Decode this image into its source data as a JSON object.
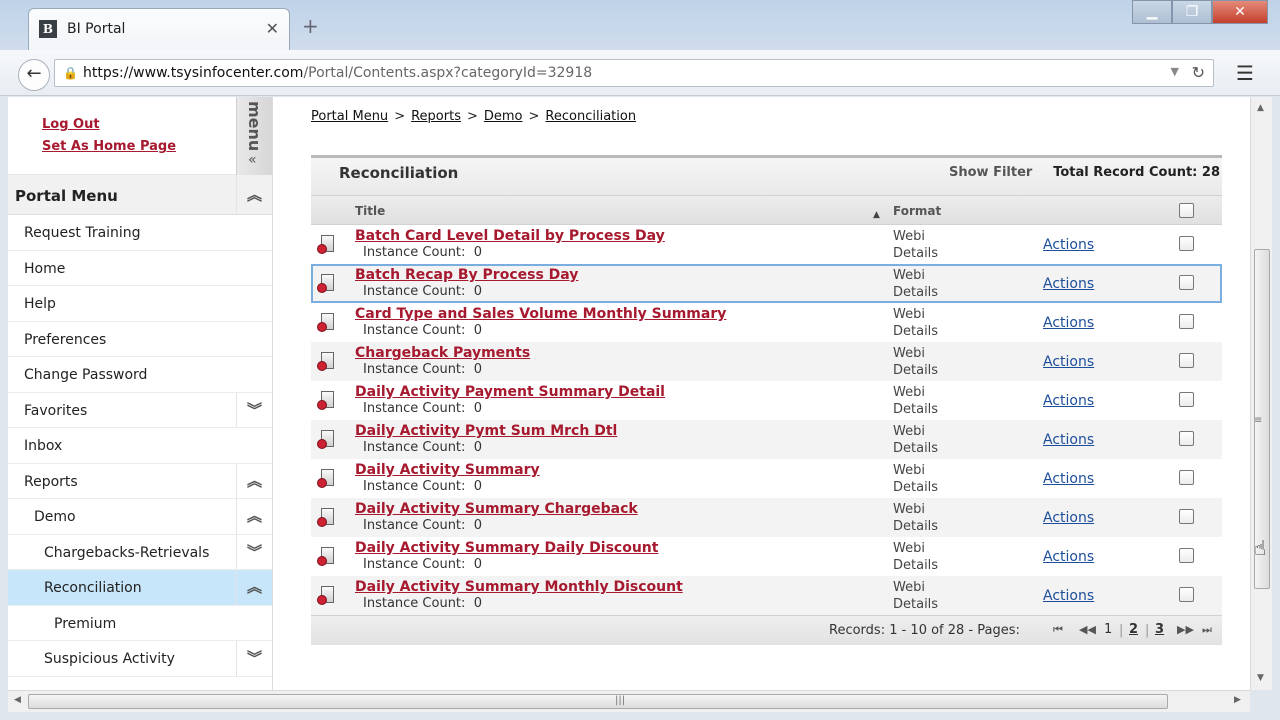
{
  "browser": {
    "tab_title": "BI Portal",
    "tab_favicon": "B",
    "new_tab": "+",
    "url_host": "https://www.tsysinfocenter.com",
    "url_path": "/Portal/Contents.aspx?categoryId=32918",
    "icons": [
      "back-arrow-icon",
      "lock-icon",
      "reload-icon",
      "hamburger-menu-icon",
      "minimize-icon",
      "maximize-icon",
      "close-icon"
    ]
  },
  "sidebar": {
    "logout": "Log Out",
    "set_home": "Set As Home Page",
    "menu_handle": "menu",
    "portal_menu": "Portal Menu",
    "items": [
      {
        "label": "Request Training",
        "level": 0
      },
      {
        "label": "Home",
        "level": 0
      },
      {
        "label": "Help",
        "level": 0
      },
      {
        "label": "Preferences",
        "level": 0
      },
      {
        "label": "Change Password",
        "level": 0
      },
      {
        "label": "Favorites",
        "level": 0,
        "chevron": "down"
      },
      {
        "label": "Inbox",
        "level": 0
      },
      {
        "label": "Reports",
        "level": 0,
        "chevron": "up"
      },
      {
        "label": "Demo",
        "level": 1,
        "chevron": "up"
      },
      {
        "label": "Chargebacks-Retrievals",
        "level": 2,
        "chevron": "down"
      },
      {
        "label": "Reconciliation",
        "level": 2,
        "chevron": "up",
        "active": true
      },
      {
        "label": "Premium",
        "level": 3
      },
      {
        "label": "Suspicious Activity",
        "level": 2,
        "chevron": "down"
      }
    ],
    "active_color": "#c7e6f9"
  },
  "breadcrumb": [
    "Portal Menu",
    "Reports",
    "Demo",
    "Reconciliation"
  ],
  "breadcrumb_sep": ">",
  "grid": {
    "title": "Reconciliation",
    "show_filter": "Show Filter",
    "total_count": "Total Record Count: 28",
    "col_title": "Title",
    "col_format": "Format",
    "instance_label": "Instance Count:",
    "rows": [
      {
        "title": "Batch Card Level Detail by Process Day",
        "instance": "0",
        "format": "Webi",
        "details": "Details",
        "actions": "Actions"
      },
      {
        "title": "Batch Recap By Process Day",
        "instance": "0",
        "format": "Webi",
        "details": "Details",
        "actions": "Actions"
      },
      {
        "title": "Card Type and Sales Volume Monthly Summary",
        "instance": "0",
        "format": "Webi",
        "details": "Details",
        "actions": "Actions"
      },
      {
        "title": "Chargeback Payments",
        "instance": "0",
        "format": "Webi",
        "details": "Details",
        "actions": "Actions"
      },
      {
        "title": "Daily Activity Payment Summary Detail",
        "instance": "0",
        "format": "Webi",
        "details": "Details",
        "actions": "Actions"
      },
      {
        "title": "Daily Activity Pymt Sum Mrch Dtl",
        "instance": "0",
        "format": "Webi",
        "details": "Details",
        "actions": "Actions"
      },
      {
        "title": "Daily Activity Summary",
        "instance": "0",
        "format": "Webi",
        "details": "Details",
        "actions": "Actions"
      },
      {
        "title": "Daily Activity Summary Chargeback",
        "instance": "0",
        "format": "Webi",
        "details": "Details",
        "actions": "Actions"
      },
      {
        "title": "Daily Activity Summary Daily Discount",
        "instance": "0",
        "format": "Webi",
        "details": "Details",
        "actions": "Actions"
      },
      {
        "title": "Daily Activity Summary Monthly Discount",
        "instance": "0",
        "format": "Webi",
        "details": "Details",
        "actions": "Actions"
      }
    ],
    "selected_row": 1,
    "pager_info": "Records: 1 - 10 of 28 - Pages:",
    "pages": [
      "1",
      "2",
      "3"
    ],
    "current_page": "1",
    "title_color": "#a6192e",
    "link_color": "#1d4e9b"
  }
}
